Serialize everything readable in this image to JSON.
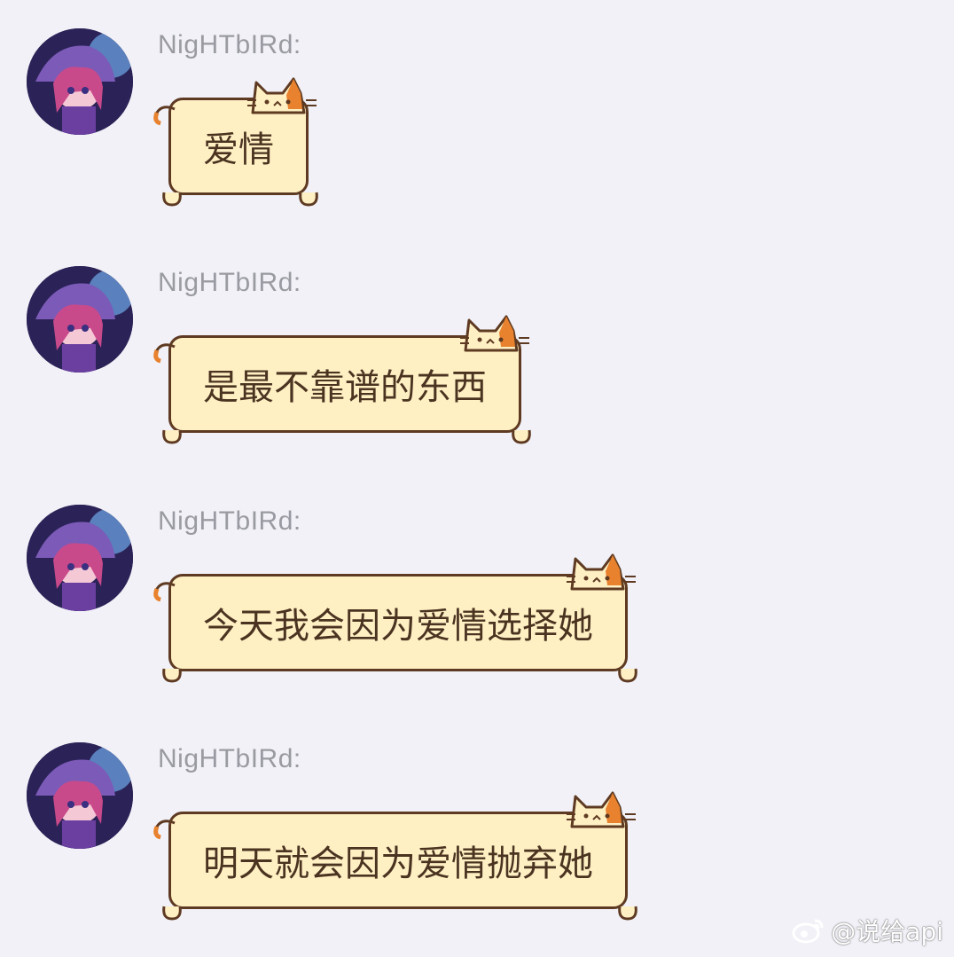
{
  "messages": [
    {
      "sender": "NigHTbIRd:",
      "text": "爱情"
    },
    {
      "sender": "NigHTbIRd:",
      "text": "是最不靠谱的东西"
    },
    {
      "sender": "NigHTbIRd:",
      "text": "今天我会因为爱情选择她"
    },
    {
      "sender": "NigHTbIRd:",
      "text": "明天就会因为爱情抛弃她"
    }
  ],
  "watermark": {
    "icon": "weibo-icon",
    "text": "@说给api"
  },
  "colors": {
    "background": "#f1f1f7",
    "bubble_fill": "#fff0c4",
    "bubble_border": "#5e3a22",
    "cat_patch": "#e8822e",
    "sender_text": "#9a9aa2"
  }
}
